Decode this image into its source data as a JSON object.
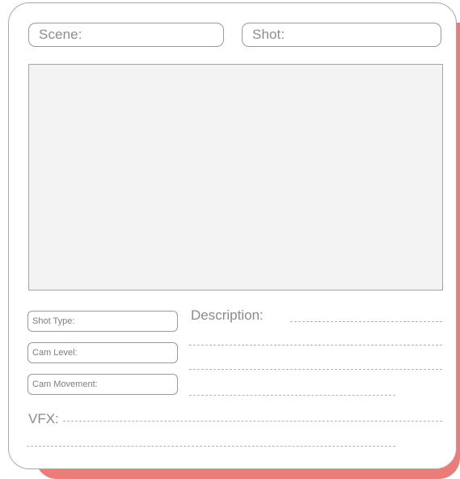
{
  "form": {
    "scene_label": "Scene:",
    "shot_label": "Shot:",
    "shot_type_label": "Shot Type:",
    "cam_level_label": "Cam Level:",
    "cam_movement_label": "Cam Movement:",
    "description_label": "Description:",
    "vfx_label": "VFX:"
  },
  "colors": {
    "accent_shadow": "#ea7c7a",
    "border": "#a9a9a9",
    "text": "#8b8b8b",
    "image_placeholder": "#f3f3f3"
  }
}
